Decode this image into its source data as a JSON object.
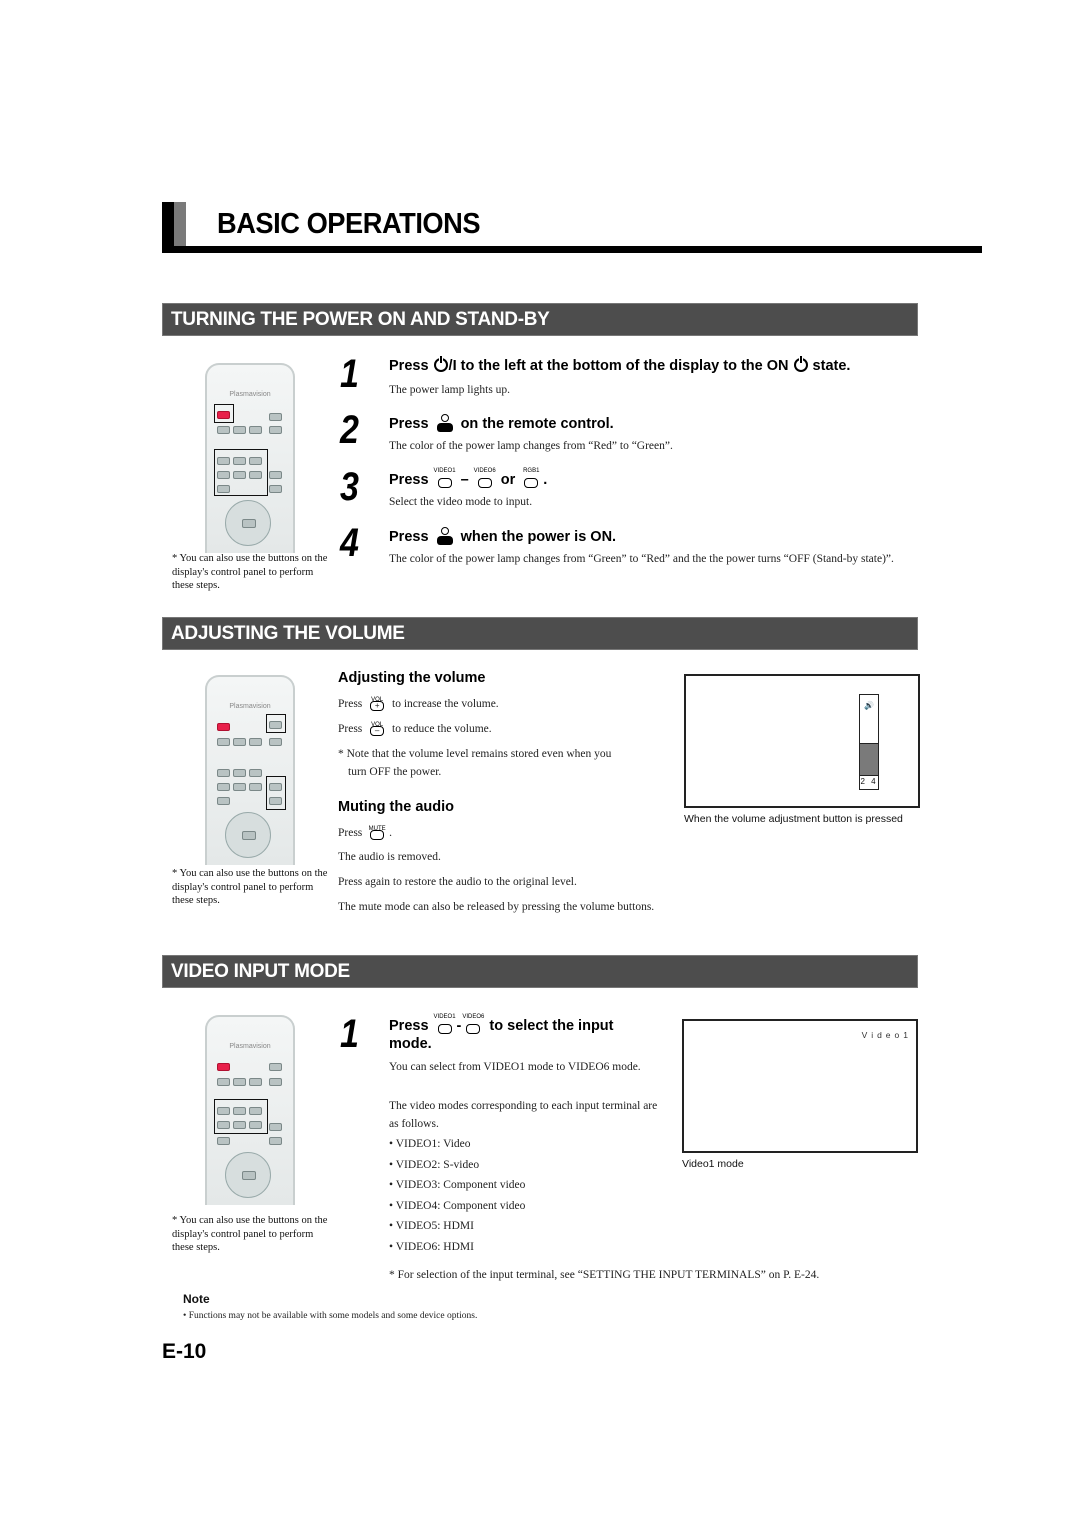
{
  "page_title": "BASIC OPERATIONS",
  "sections": {
    "power": {
      "header": "TURNING THE POWER ON AND STAND-BY",
      "remote_note": "* You can also use the buttons on the display's control panel to perform these steps.",
      "steps": [
        {
          "num": "1",
          "head_pre": "Press",
          "head_mid": "/I to the left at the bottom of the display to the ON",
          "head_post": "state.",
          "body": "The power lamp lights up."
        },
        {
          "num": "2",
          "head_pre": "Press",
          "head_post": "on the remote control.",
          "body": "The color of the power lamp changes from “Red” to “Green”."
        },
        {
          "num": "3",
          "head_pre": "Press",
          "btn1": "VIDEO1",
          "dash": "–",
          "btn2": "VIDEO6",
          "or": "or",
          "btn3": "RGB1",
          "period": ".",
          "body": "Select the video mode to input."
        },
        {
          "num": "4",
          "head_pre": "Press",
          "head_post": "when the power is ON.",
          "body": "The color of the power lamp changes from “Green” to “Red” and the the power turns “OFF (Stand-by state)”."
        }
      ]
    },
    "volume": {
      "header": "ADJUSTING THE VOLUME",
      "remote_note": "* You can also use the buttons on the display's control panel to perform these steps.",
      "adjust_head": "Adjusting the volume",
      "press": "Press",
      "vol_label": "VOL",
      "plus": "+",
      "minus": "–",
      "increase_text": "to increase the volume.",
      "reduce_text": "to reduce the volume.",
      "note_line1": "* Note that the volume level remains stored even when you",
      "note_line2": "turn OFF the power.",
      "mute_head": "Muting the audio",
      "mute_label": "MUTE",
      "mute_period": ".",
      "removed": "The audio is removed.",
      "restore": "Press again to restore the audio to the original level.",
      "release": "The mute mode can also be released by pressing the volume buttons.",
      "osd": {
        "level": "2 4",
        "level_fraction": 0.4,
        "icon": "speaker-icon"
      },
      "caption": "When the volume adjustment button is pressed"
    },
    "video_input": {
      "header": "VIDEO INPUT MODE",
      "remote_note": "* You can also use the buttons on the display's control panel to perform these steps.",
      "step": {
        "num": "1",
        "head_pre": "Press",
        "btn1": "VIDEO1",
        "dash": "-",
        "btn2": "VIDEO6",
        "head_post": "to select the input",
        "head_line2": "mode.",
        "body1": "You can select from VIDEO1 mode to VIDEO6 mode.",
        "body2": "The video modes corresponding to each input terminal are as follows."
      },
      "modes": [
        "VIDEO1: Video",
        "VIDEO2: S-video",
        "VIDEO3: Component video",
        "VIDEO4: Component video",
        "VIDEO5: HDMI",
        "VIDEO6: HDMI"
      ],
      "osd_label": "Video1",
      "caption": "Video1 mode",
      "footnote": "* For selection of the input terminal, see “SETTING THE INPUT TERMINALS” on P. E-24."
    }
  },
  "note": {
    "head": "Note",
    "body": "•  Functions may not be available with some models and some device options."
  },
  "remote": {
    "brand": "Plasmavision",
    "power_color": "#e8204a"
  },
  "page_number": "E-10"
}
